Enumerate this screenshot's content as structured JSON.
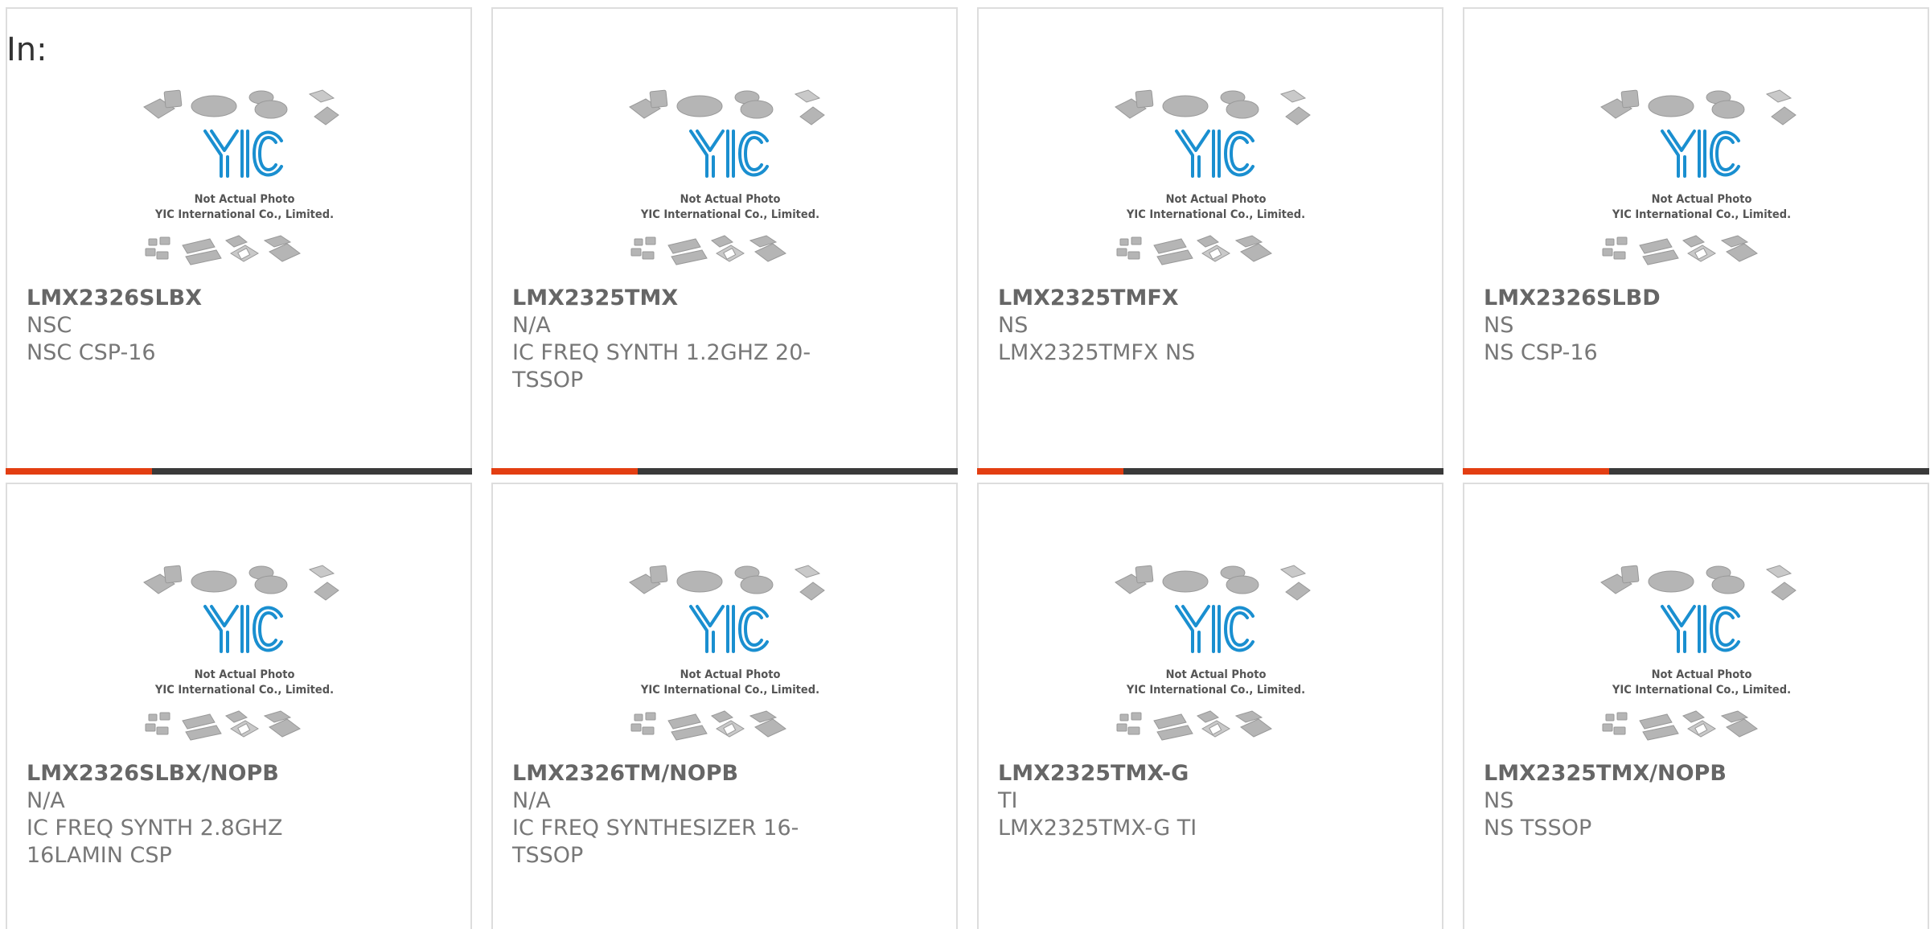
{
  "header": {
    "label": "In:"
  },
  "placeholder": {
    "logo_text": "YIC",
    "line1": "Not Actual Photo",
    "line2": "YIC International Co., Limited."
  },
  "colors": {
    "accent": "#e33e12",
    "bar": "#3a3a3a",
    "logo": "#1a8fd0",
    "text": "#777777"
  },
  "products": [
    {
      "part": "LMX2326SLBX",
      "mfr": "NSC",
      "desc": "NSC CSP-16"
    },
    {
      "part": "LMX2325TMX",
      "mfr": "N/A",
      "desc": "IC FREQ SYNTH 1.2GHZ 20-TSSOP"
    },
    {
      "part": "LMX2325TMFX",
      "mfr": "NS",
      "desc": "LMX2325TMFX NS"
    },
    {
      "part": "LMX2326SLBD",
      "mfr": "NS",
      "desc": "NS CSP-16"
    },
    {
      "part": "LMX2326SLBX/NOPB",
      "mfr": "N/A",
      "desc": "IC FREQ SYNTH 2.8GHZ 16LAMIN CSP"
    },
    {
      "part": "LMX2326TM/NOPB",
      "mfr": "N/A",
      "desc": "IC FREQ SYNTHESIZER 16-TSSOP"
    },
    {
      "part": "LMX2325TMX-G",
      "mfr": "TI",
      "desc": "LMX2325TMX-G TI"
    },
    {
      "part": "LMX2325TMX/NOPB",
      "mfr": "NS",
      "desc": "NS TSSOP"
    }
  ]
}
